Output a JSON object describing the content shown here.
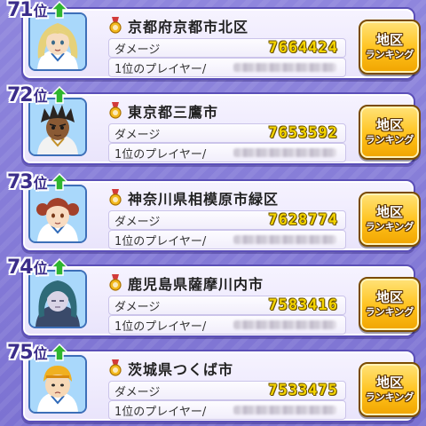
{
  "rank_suffix": "位",
  "damage_label": "ダメージ",
  "player_label": "1位のプレイヤー/",
  "button": {
    "line1": "地区",
    "line2": "ランキング"
  },
  "colors": {
    "background": "#8f86dd",
    "card_border": "#5b4fb8",
    "damage_value": "#f4d400",
    "button": "#ffc21c",
    "rank_up_arrow": "#2fb52f"
  },
  "icons": {
    "rank_change": "green-up-arrow-icon",
    "region": "medal-icon"
  },
  "rows": [
    {
      "rank": "71",
      "region": "京都府京都市北区",
      "damage": "7664424"
    },
    {
      "rank": "72",
      "region": "東京都三鷹市",
      "damage": "7653592"
    },
    {
      "rank": "73",
      "region": "神奈川県相模原市緑区",
      "damage": "7628774"
    },
    {
      "rank": "74",
      "region": "鹿児島県薩摩川内市",
      "damage": "7583416"
    },
    {
      "rank": "75",
      "region": "茨城県つくば市",
      "damage": "7533475"
    }
  ]
}
